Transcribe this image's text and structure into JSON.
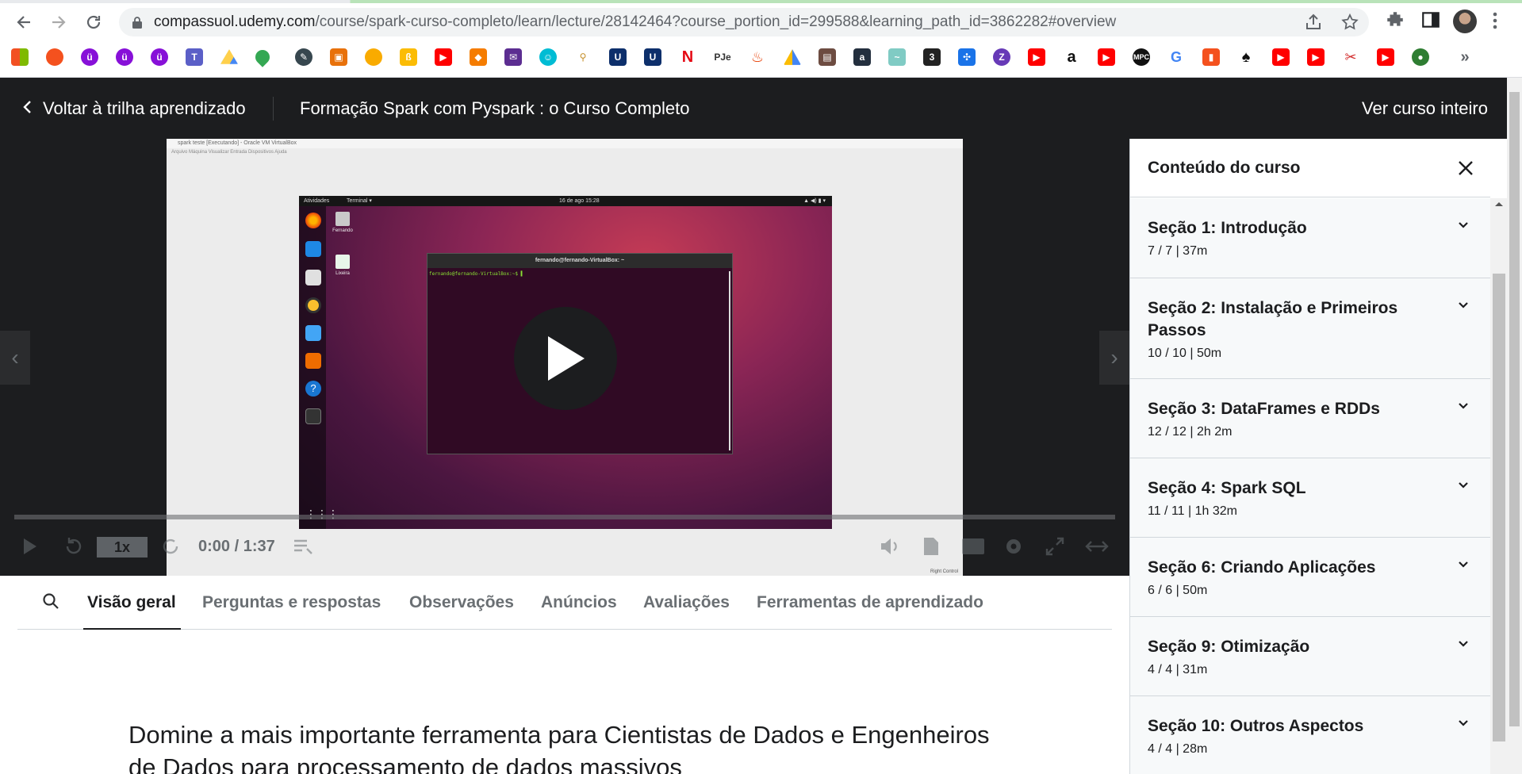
{
  "browser": {
    "url_host": "compassuol.udemy.com",
    "url_path": "/course/spark-curso-completo/learn/lecture/28142464?course_portion_id=299588&learning_path_id=3862282#overview",
    "bookmark_icons": [
      "microsoft-icon",
      "chrome-fruit-icon",
      "udemy-icon",
      "udemy-icon",
      "udemy-icon",
      "teams-icon",
      "drive-icon",
      "maps-icon",
      "pen-icon",
      "contacts-icon",
      "flame-icon",
      "bitcoin-icon",
      "youtube-icon",
      "box-icon",
      "mail-icon",
      "cloud-icon",
      "plug-icon",
      "shield-icon",
      "shield-icon",
      "netflix-icon",
      "pje-icon",
      "fire-icon",
      "triangle-icon",
      "image-icon",
      "amazon-icon",
      "wave-icon",
      "clapper-icon",
      "puzzle-icon",
      "z-icon",
      "youtube-icon",
      "amazon-icon",
      "youtube-icon",
      "mpc-icon",
      "google-icon",
      "file-icon",
      "spade-icon",
      "youtube-icon",
      "youtube-icon",
      "tools-icon",
      "youtube-icon",
      "globe-icon"
    ],
    "more_bookmarks": "»"
  },
  "header": {
    "back_label": "Voltar à trilha aprendizado",
    "course_title": "Formação Spark com Pyspark : o Curso Completo",
    "see_full_label": "Ver curso inteiro"
  },
  "video": {
    "vm_title": "spark teste [Executando] - Oracle VM VirtualBox",
    "vm_menu": "Arquivo   Máquina   Visualizar   Entrada   Dispositivos   Ajuda",
    "desktop_activities": "Atividades",
    "desktop_terminal": "Terminal ▾",
    "desktop_clock": "16 de ago  15:28",
    "desktop_file1": "Fernando",
    "desktop_file2": "Lixeira",
    "terminal_title": "fernando@fernando-VirtualBox: ~",
    "terminal_prompt": "fernando@fernando-VirtualBox:~$ ▌",
    "tray_text": "Right Control",
    "speed_label": "1x",
    "timecode": "0:00 / 1:37",
    "progress": 0
  },
  "tabs": {
    "items": [
      {
        "label": "Visão geral"
      },
      {
        "label": "Perguntas e respostas"
      },
      {
        "label": "Observações"
      },
      {
        "label": "Anúncios"
      },
      {
        "label": "Avaliações"
      },
      {
        "label": "Ferramentas de aprendizado"
      }
    ],
    "active": "Visão geral"
  },
  "description": "Domine a mais importante ferramenta para Cientistas de Dados e Engenheiros de Dados para processamento de dados massivos",
  "sidebar": {
    "title": "Conteúdo do curso",
    "sections": [
      {
        "title": "Seção 1: Introdução",
        "meta": "7 / 7 | 37m"
      },
      {
        "title": "Seção 2: Instalação e Primeiros Passos",
        "meta": "10 / 10 | 50m"
      },
      {
        "title": "Seção 3: DataFrames e RDDs",
        "meta": "12 / 12 | 2h 2m"
      },
      {
        "title": "Seção 4: Spark SQL",
        "meta": "11 / 11 | 1h 32m"
      },
      {
        "title": "Seção 6: Criando Aplicações",
        "meta": "6 / 6 | 50m"
      },
      {
        "title": "Seção 9: Otimização",
        "meta": "4 / 4 | 31m"
      },
      {
        "title": "Seção 10: Outros Aspectos",
        "meta": "4 / 4 | 28m"
      }
    ]
  },
  "colors": {
    "header_bg": "#1c1d1f",
    "section_bg": "#f7f9fa",
    "muted_text": "#6a6f73"
  }
}
